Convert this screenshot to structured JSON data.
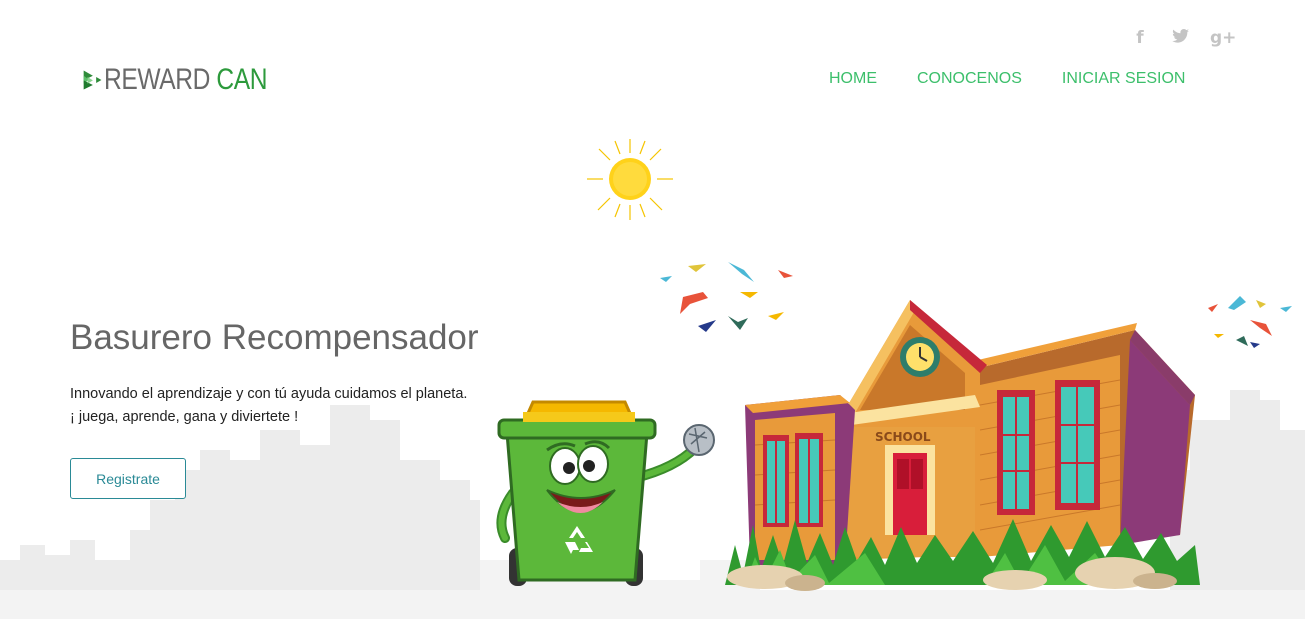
{
  "brand": {
    "word1": "REWARD",
    "word2": " CAN",
    "logo_icon": "recycle-arrows-logo-icon"
  },
  "social": [
    {
      "icon": "facebook-icon",
      "glyph": "f"
    },
    {
      "icon": "twitter-icon",
      "glyph": "🐦"
    },
    {
      "icon": "google-plus-icon",
      "glyph": "g+"
    }
  ],
  "nav": {
    "home": "HOME",
    "about": "CONOCENOS",
    "login": "INICIAR SESION"
  },
  "hero": {
    "title": "Basurero Recompensador",
    "line1": "Innovando el aprendizaje y con tú ayuda cuidamos el planeta.",
    "line2": "¡ juega, aprende, gana y diviertete !",
    "button": "Registrate"
  },
  "illustration": {
    "school_sign": "SCHOOL"
  },
  "colors": {
    "nav": "#3cbf6b",
    "brand_green": "#2d9a3c",
    "button": "#2a8a96",
    "bin_green": "#5cb83a",
    "bin_lid": "#f5b800"
  }
}
